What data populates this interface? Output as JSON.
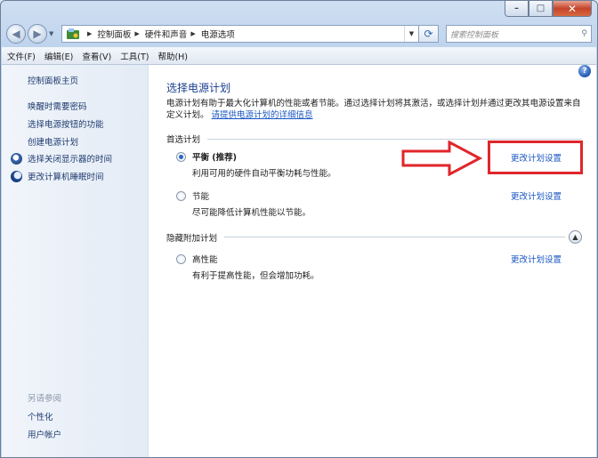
{
  "window": {
    "minimize": "–",
    "maximize": "□",
    "close": "✕"
  },
  "nav": {
    "breadcrumbs": [
      "控制面板",
      "硬件和声音",
      "电源选项"
    ],
    "search_placeholder": "搜索控制面板"
  },
  "menu": [
    "文件(F)",
    "编辑(E)",
    "查看(V)",
    "工具(T)",
    "帮助(H)"
  ],
  "sidebar": {
    "home": "控制面板主页",
    "links": [
      "唤醒时需要密码",
      "选择电源按钮的功能",
      "创建电源计划"
    ],
    "icon_links": [
      {
        "label": "选择关闭显示器的时间",
        "icon": "monitor-icon"
      },
      {
        "label": "更改计算机睡眠时间",
        "icon": "moon-icon"
      }
    ],
    "see_also": "另请参阅",
    "see_also_links": [
      "个性化",
      "用户帐户"
    ]
  },
  "main": {
    "title": "选择电源计划",
    "desc_text": "电源计划有助于最大化计算机的性能或者节能。通过选择计划将其激活，或选择计划并通过更改其电源设置来自定义计划。",
    "desc_link": "请提供电源计划的详细信息",
    "preferred_header": "首选计划",
    "hidden_header": "隐藏附加计划",
    "plans": [
      {
        "name": "平衡 (推荐)",
        "desc": "利用可用的硬件自动平衡功耗与性能。",
        "checked": true,
        "link": "更改计划设置"
      },
      {
        "name": "节能",
        "desc": "尽可能降低计算机性能以节能。",
        "checked": false,
        "link": "更改计划设置"
      },
      {
        "name": "高性能",
        "desc": "有利于提高性能，但会增加功耗。",
        "checked": false,
        "link": "更改计划设置"
      }
    ]
  },
  "annotation_color": "#e0262a"
}
